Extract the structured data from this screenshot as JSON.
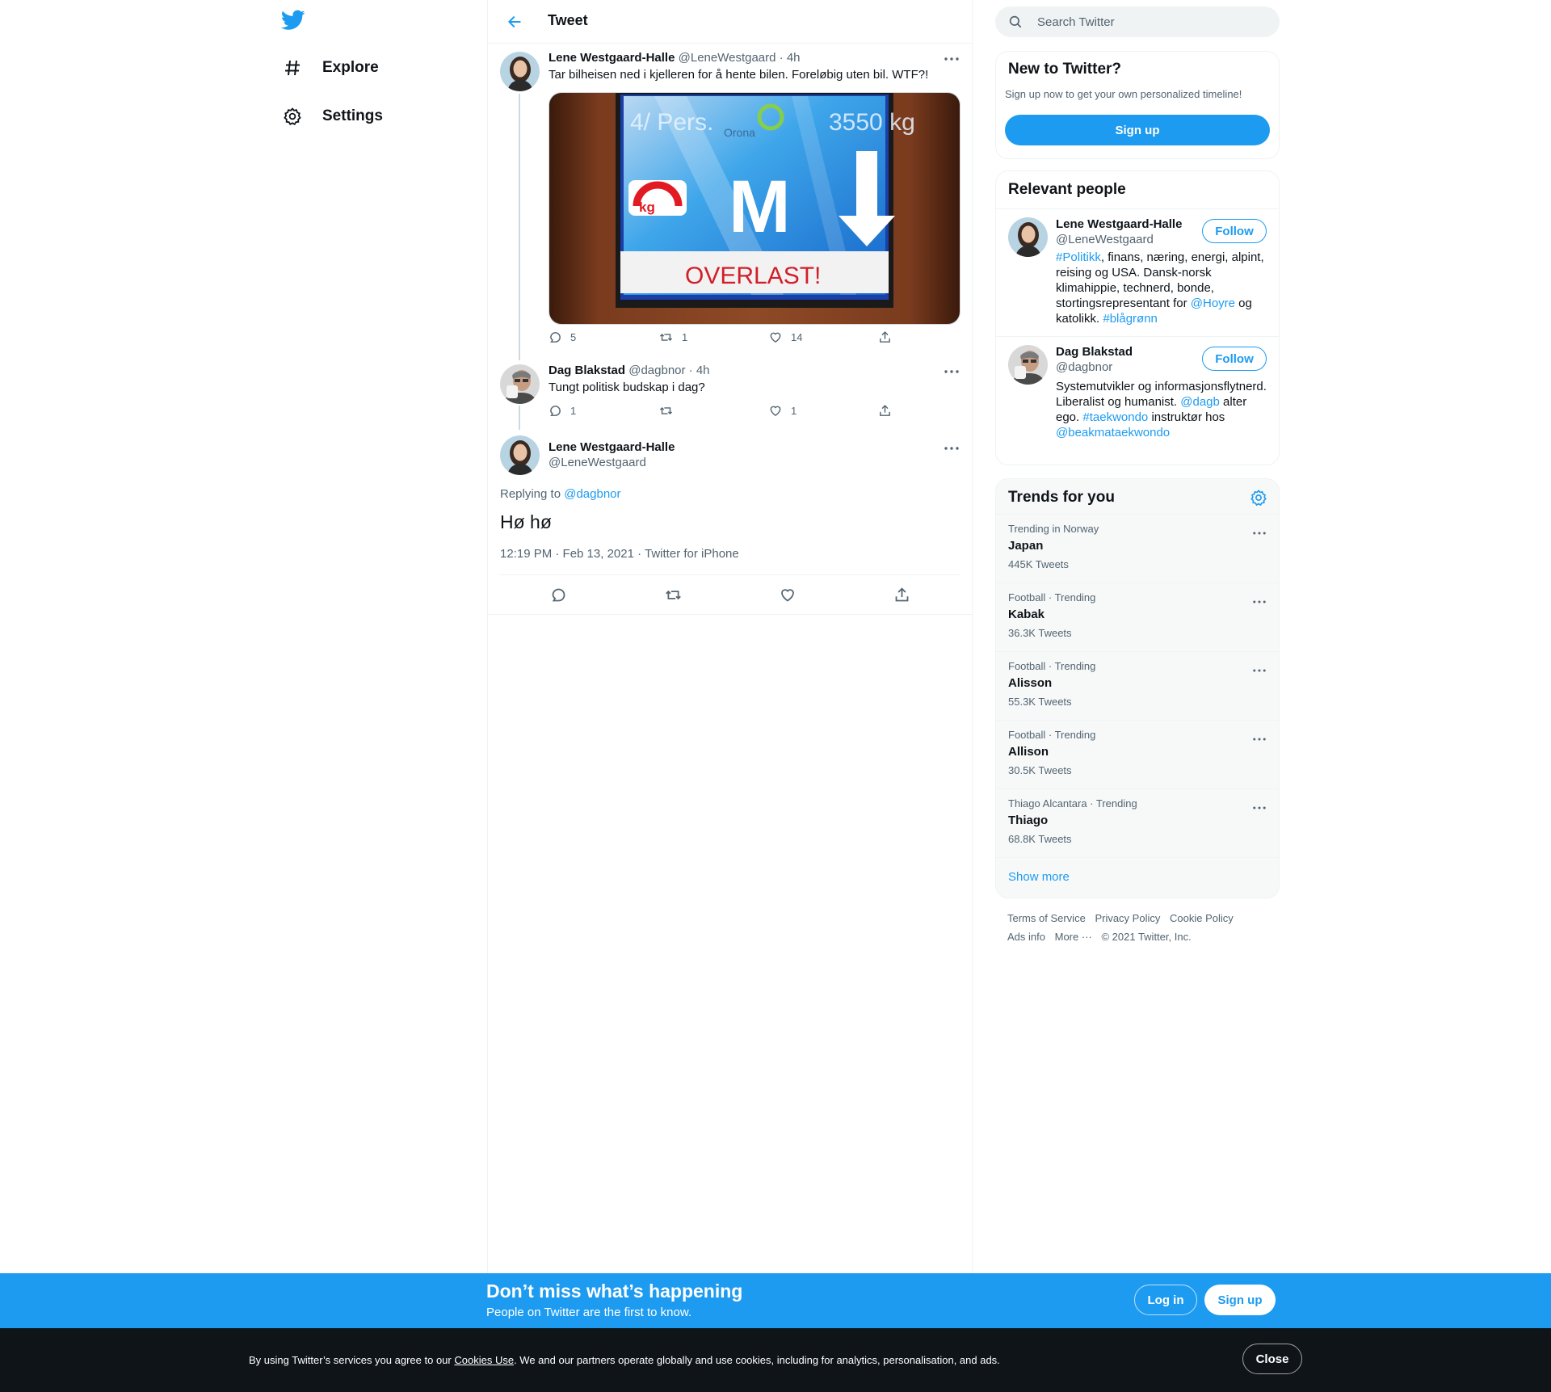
{
  "nav": {
    "logo": "twitter-bird-icon",
    "items": [
      {
        "label": "Explore",
        "icon": "hashtag-icon"
      },
      {
        "label": "Settings",
        "icon": "gear-icon"
      }
    ]
  },
  "header": {
    "title": "Tweet"
  },
  "thread": [
    {
      "name": "Lene Westgaard-Halle",
      "handle": "@LeneWestgaard",
      "time": "· 4h",
      "text": "Tar bilheisen ned i kjelleren for å hente bilen. Foreløbig uten bil. WTF?!",
      "media": {
        "top_left": "4/ Pers.",
        "brand": "Orona",
        "top_right": "3550 kg",
        "badge": "kg",
        "floor": "M",
        "banner": "OVERLAST!"
      },
      "replies": "5",
      "retweets": "1",
      "likes": "14"
    },
    {
      "name": "Dag Blakstad",
      "handle": "@dagbnor",
      "time": "· 4h",
      "text": "Tungt politisk budskap i dag?",
      "replies": "1",
      "retweets": "",
      "likes": "1"
    }
  ],
  "focus": {
    "name": "Lene Westgaard-Halle",
    "handle": "@LeneWestgaard",
    "replying_prefix": "Replying to",
    "replying_to": "@dagbnor",
    "text": "Hø hø",
    "timestamp": "12:19 PM · Feb 13, 2021",
    "source_sep": "·",
    "source": "Twitter for iPhone"
  },
  "search": {
    "placeholder": "Search Twitter"
  },
  "new_to_twitter": {
    "title": "New to Twitter?",
    "subtitle": "Sign up now to get your own personalized timeline!",
    "button": "Sign up"
  },
  "relevant": {
    "title": "Relevant people",
    "people": [
      {
        "name": "Lene Westgaard-Halle",
        "handle": "@LeneWestgaard",
        "follow": "Follow",
        "bio": [
          {
            "t": "#Politikk",
            "link": true
          },
          {
            "t": ", finans, næring, energi, alpint, reising og USA. Dansk-norsk klimahippie, technerd, bonde, stortingsrepresentant for ",
            "link": false
          },
          {
            "t": "@Hoyre",
            "link": true
          },
          {
            "t": " og katolikk. ",
            "link": false
          },
          {
            "t": "#blågrønn",
            "link": true
          }
        ]
      },
      {
        "name": "Dag Blakstad",
        "handle": "@dagbnor",
        "follow": "Follow",
        "bio": [
          {
            "t": "Systemutvikler og informasjonsflytnerd. Liberalist og humanist. ",
            "link": false
          },
          {
            "t": "@dagb",
            "link": true
          },
          {
            "t": " alter ego. ",
            "link": false
          },
          {
            "t": "#taekwondo",
            "link": true
          },
          {
            "t": " instruktør hos ",
            "link": false
          },
          {
            "t": "@beakmataekwondo",
            "link": true
          }
        ]
      }
    ]
  },
  "trends": {
    "title": "Trends for you",
    "items": [
      {
        "context": "Trending in Norway",
        "name": "Japan",
        "count": "445K Tweets"
      },
      {
        "context": "Football · Trending",
        "name": "Kabak",
        "count": "36.3K Tweets"
      },
      {
        "context": "Football · Trending",
        "name": "Alisson",
        "count": "55.3K Tweets"
      },
      {
        "context": "Football · Trending",
        "name": "Allison",
        "count": "30.5K Tweets"
      },
      {
        "context": "Thiago Alcantara · Trending",
        "name": "Thiago",
        "count": "68.8K Tweets"
      }
    ],
    "show_more": "Show more"
  },
  "footer": {
    "links1": [
      "Terms of Service",
      "Privacy Policy",
      "Cookie Policy"
    ],
    "links2": [
      "Ads info",
      "More ···",
      "© 2021 Twitter, Inc."
    ]
  },
  "signup_bar": {
    "headline": "Don’t miss what’s happening",
    "sub": "People on Twitter are the first to know.",
    "login": "Log in",
    "signup": "Sign up"
  },
  "cookie_bar": {
    "pre": "By using Twitter’s services you agree to our ",
    "link": "Cookies Use",
    "post": ". We and our partners operate globally and use cookies, including for analytics, personalisation, and ads.",
    "close": "Close"
  },
  "colors": {
    "accent": "#1d9bf0",
    "text": "#0f1419",
    "muted": "#536471",
    "border": "#eff3f4"
  }
}
